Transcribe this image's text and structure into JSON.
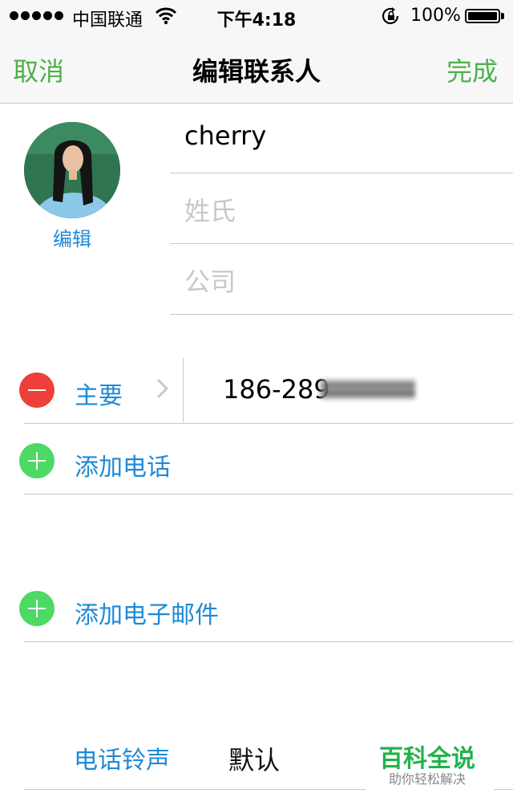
{
  "status_bar": {
    "carrier": "中国联通",
    "time": "下午4:18",
    "battery": "100%"
  },
  "nav": {
    "cancel": "取消",
    "title": "编辑联系人",
    "done": "完成"
  },
  "avatar": {
    "edit_label": "编辑"
  },
  "fields": {
    "first_name": "cherry",
    "last_name_placeholder": "姓氏",
    "company_placeholder": "公司"
  },
  "phone": {
    "label": "主要",
    "number": "186-289"
  },
  "add_phone": "添加电话",
  "add_email": "添加电子邮件",
  "ringtone": {
    "label": "电话铃声",
    "value": "默认"
  },
  "watermark": {
    "title": "百科全说",
    "subtitle": "助你轻松解决"
  }
}
